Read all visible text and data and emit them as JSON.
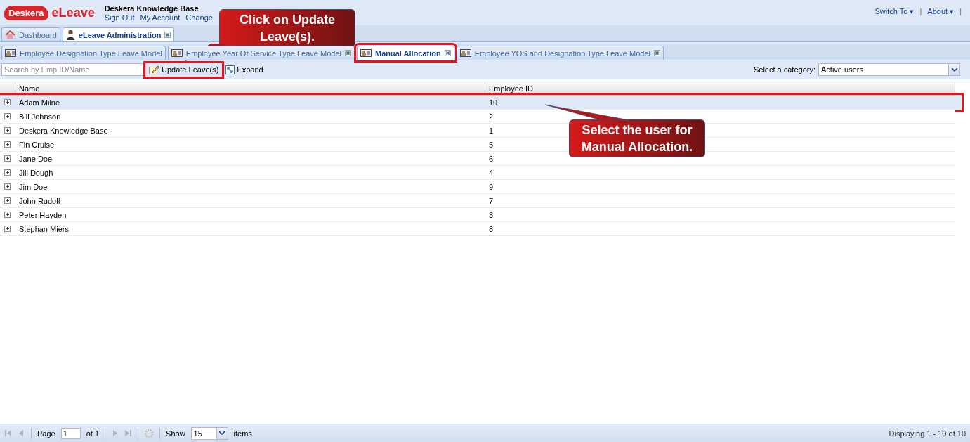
{
  "header": {
    "logo": "Deskera",
    "app_name": "eLeave",
    "company": "Deskera Knowledge Base",
    "links": [
      "Sign Out",
      "My Account",
      "Change"
    ],
    "menus": [
      {
        "label": "Switch To",
        "caret": "▾",
        "separator": "|"
      },
      {
        "label": "About",
        "caret": "▾",
        "separator": "|"
      }
    ]
  },
  "main_tabs": [
    {
      "label": "Dashboard",
      "selected": false,
      "closable": false,
      "kind": "home"
    },
    {
      "label": "eLeave Administration",
      "selected": true,
      "closable": true,
      "kind": "person"
    }
  ],
  "sub_tabs": [
    {
      "label": "Employee Designation Type Leave Model",
      "selected": false,
      "closable": false,
      "highlighted": false
    },
    {
      "label": "Employee Year Of Service Type Leave Model",
      "selected": false,
      "closable": true,
      "highlighted": false
    },
    {
      "label": "Manual Allocation",
      "selected": true,
      "closable": true,
      "highlighted": true
    },
    {
      "label": "Employee YOS and Designation Type Leave Model",
      "selected": false,
      "closable": true,
      "highlighted": false
    }
  ],
  "toolbar": {
    "search": {
      "placeholder": "Search by Emp ID/Name"
    },
    "buttons": [
      {
        "label": "Update Leave(s)",
        "kind": "edit",
        "highlighted": true
      },
      {
        "label": "Expand",
        "kind": "expand",
        "highlighted": false
      }
    ],
    "category_label": "Select a category:",
    "category_value": "Active users"
  },
  "table": {
    "columns": [
      "Name",
      "Employee ID"
    ],
    "rows": [
      {
        "name": "Adam Milne",
        "id": "10",
        "selected": true
      },
      {
        "name": "Bill Johnson",
        "id": "2",
        "selected": false
      },
      {
        "name": "Deskera Knowledge Base",
        "id": "1",
        "selected": false
      },
      {
        "name": "Fin Cruise",
        "id": "5",
        "selected": false
      },
      {
        "name": "Jane Doe",
        "id": "6",
        "selected": false
      },
      {
        "name": "Jill Dough",
        "id": "4",
        "selected": false
      },
      {
        "name": "Jim Doe",
        "id": "9",
        "selected": false
      },
      {
        "name": "John Rudolf",
        "id": "7",
        "selected": false
      },
      {
        "name": "Peter Hayden",
        "id": "3",
        "selected": false
      },
      {
        "name": "Stephan Miers",
        "id": "8",
        "selected": false
      }
    ]
  },
  "paging": {
    "page_label": "Page",
    "page_value": "1",
    "of_label": "of 1",
    "show_label": "Show",
    "show_value": "15",
    "items_label": "items",
    "display_info": "Displaying 1 - 10 of 10"
  },
  "annotations": [
    {
      "kind": "update",
      "text": "Click on Update Leave(s)."
    },
    {
      "kind": "row",
      "text": "Select the user for Manual Allocation."
    }
  ]
}
